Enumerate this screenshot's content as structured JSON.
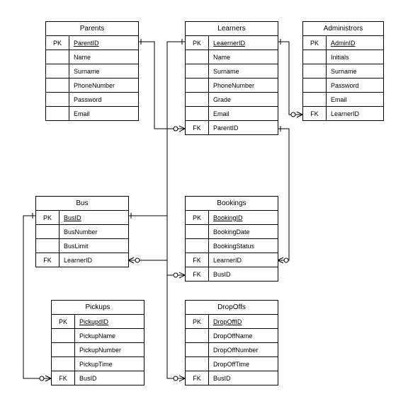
{
  "entities": {
    "parents": {
      "title": "Parents",
      "rows": [
        {
          "key": "PK",
          "field": "ParentID",
          "pk": true
        },
        {
          "key": "",
          "field": "Name"
        },
        {
          "key": "",
          "field": "Surname"
        },
        {
          "key": "",
          "field": "PhoneNumber"
        },
        {
          "key": "",
          "field": "Password"
        },
        {
          "key": "",
          "field": "Email"
        }
      ]
    },
    "learners": {
      "title": "Learners",
      "rows": [
        {
          "key": "PK",
          "field": "LeaernerID",
          "pk": true
        },
        {
          "key": "",
          "field": "Name"
        },
        {
          "key": "",
          "field": "Surname"
        },
        {
          "key": "",
          "field": "PhoneNumber"
        },
        {
          "key": "",
          "field": "Grade"
        },
        {
          "key": "",
          "field": "Email"
        },
        {
          "key": "FK",
          "field": "ParentID"
        }
      ]
    },
    "admins": {
      "title": "Administrors",
      "rows": [
        {
          "key": "PK",
          "field": "AdminID",
          "pk": true
        },
        {
          "key": "",
          "field": "Initials"
        },
        {
          "key": "",
          "field": "Surname"
        },
        {
          "key": "",
          "field": "Password"
        },
        {
          "key": "",
          "field": "Email"
        },
        {
          "key": "FK",
          "field": "LearnerID"
        }
      ]
    },
    "bus": {
      "title": "Bus",
      "rows": [
        {
          "key": "PK",
          "field": "BusID",
          "pk": true
        },
        {
          "key": "",
          "field": "BusNumber"
        },
        {
          "key": "",
          "field": "BusLimit"
        },
        {
          "key": "FK",
          "field": "LearnerID"
        }
      ]
    },
    "bookings": {
      "title": "Bookings",
      "rows": [
        {
          "key": "PK",
          "field": "BookingID",
          "pk": true
        },
        {
          "key": "",
          "field": "BookingDate"
        },
        {
          "key": "",
          "field": "BookingStatus"
        },
        {
          "key": "FK",
          "field": "LearnerID"
        },
        {
          "key": "FK",
          "field": "BusID"
        }
      ]
    },
    "pickups": {
      "title": "Pickups",
      "rows": [
        {
          "key": "PK",
          "field": "PickupdID",
          "pk": true
        },
        {
          "key": "",
          "field": "PickupName"
        },
        {
          "key": "",
          "field": "PickupNumber"
        },
        {
          "key": "",
          "field": "PickupTime"
        },
        {
          "key": "FK",
          "field": "BusID"
        }
      ]
    },
    "dropoffs": {
      "title": "DropOffs",
      "rows": [
        {
          "key": "PK",
          "field": "DropOffID",
          "pk": true
        },
        {
          "key": "",
          "field": "DropOffName"
        },
        {
          "key": "",
          "field": "DropOffNumber"
        },
        {
          "key": "",
          "field": "DropOffTime"
        },
        {
          "key": "FK",
          "field": "BusID"
        }
      ]
    }
  }
}
